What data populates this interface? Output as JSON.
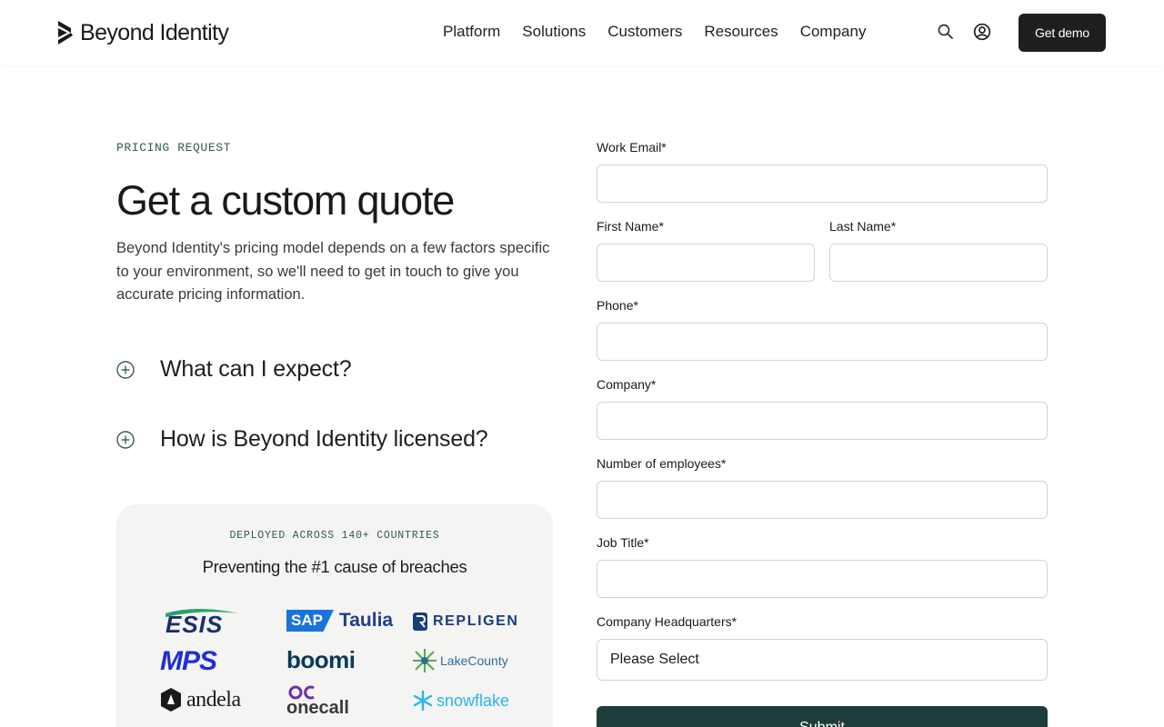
{
  "header": {
    "brand": "Beyond Identity",
    "nav": [
      "Platform",
      "Solutions",
      "Customers",
      "Resources",
      "Company"
    ],
    "search_icon": "search-icon",
    "account_icon": "user-circle-icon",
    "cta_label": "Get demo"
  },
  "hero": {
    "eyebrow": "PRICING REQUEST",
    "title": "Get a custom quote",
    "intro": "Beyond Identity's pricing model depends on a few factors specific to your environment, so we'll need to get in touch to give you accurate pricing information.",
    "faqs": [
      {
        "label": "What can I expect?",
        "icon": "plus-circle-icon"
      },
      {
        "label": "How is Beyond Identity licensed?",
        "icon": "plus-circle-icon"
      }
    ]
  },
  "logos": {
    "eyebrow": "DEPLOYED ACROSS 140+ COUNTRIES",
    "title": "Preventing the #1 cause of breaches",
    "items": [
      "ESIS",
      "SAP",
      "Taulia",
      "REPLIGEN",
      "MPS",
      "boomi",
      "LakeCounty",
      "andela",
      "onecall",
      "snowflake"
    ]
  },
  "form": {
    "email_label": "Work Email*",
    "first_name_label": "First Name*",
    "last_name_label": "Last Name*",
    "phone_label": "Phone*",
    "company_label": "Company*",
    "employees_label": "Number of employees*",
    "job_title_label": "Job Title*",
    "hq_label": "Company Headquarters*",
    "hq_value": "Please Select",
    "submit_label": "Submit"
  },
  "colors": {
    "accent": "#1d3d3b",
    "eyebrow": "#2e5a57",
    "cta": "#1f1f1f"
  }
}
